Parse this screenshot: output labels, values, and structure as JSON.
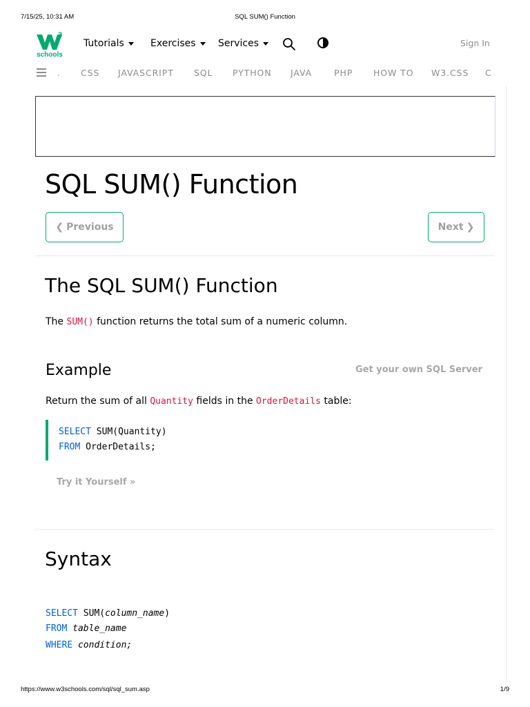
{
  "print_header": {
    "datetime": "7/15/25, 10:31 AM",
    "doc_title": "SQL SUM() Function"
  },
  "print_footer": {
    "url": "https://www.w3schools.com/sql/sql_sum.asp",
    "page": "1/9"
  },
  "logo": {
    "mark": "W",
    "superscript": "3",
    "text": "schools",
    "color": "#04aa6d"
  },
  "topnav": {
    "tutorials": "Tutorials",
    "exercises": "Exercises",
    "services": "Services",
    "search_icon": "search-icon",
    "contrast_icon": "contrast-icon",
    "signin": "Sign In"
  },
  "subjects": {
    "dot": ".",
    "items": [
      "CSS",
      "JAVASCRIPT",
      "SQL",
      "PYTHON",
      "JAVA",
      "PHP",
      "HOW TO",
      "W3.CSS",
      "C"
    ]
  },
  "page_title": "SQL SUM() Function",
  "pager": {
    "previous": "Previous",
    "next": "Next"
  },
  "section": {
    "title": "The SQL SUM() Function",
    "intro_before": "The",
    "intro_code": "SUM()",
    "intro_after": "function returns the total sum of a numeric column."
  },
  "example": {
    "title": "Example",
    "get_server": "Get your own SQL Server",
    "desc_before": "Return the sum of all",
    "desc_code1": "Quantity",
    "desc_mid": "fields in the",
    "desc_code2": "OrderDetails",
    "desc_after": "table:",
    "code": {
      "line1_kw": "SELECT",
      "line1_rest": "SUM(Quantity)",
      "line2_kw": "FROM",
      "line2_rest": "OrderDetails;"
    },
    "try_it": "Try it Yourself »"
  },
  "syntax": {
    "title": "Syntax",
    "line1_kw": "SELECT",
    "line1_fn": "SUM(",
    "line1_arg": "column_name",
    "line1_close": ")",
    "line2_kw": "FROM",
    "line2_arg": "table_name",
    "line3_kw": "WHERE",
    "line3_arg": "condition;"
  },
  "colors": {
    "accent": "#04aa6d",
    "code_keyword": "#dc143c",
    "sql_keyword": "#0060dc"
  }
}
